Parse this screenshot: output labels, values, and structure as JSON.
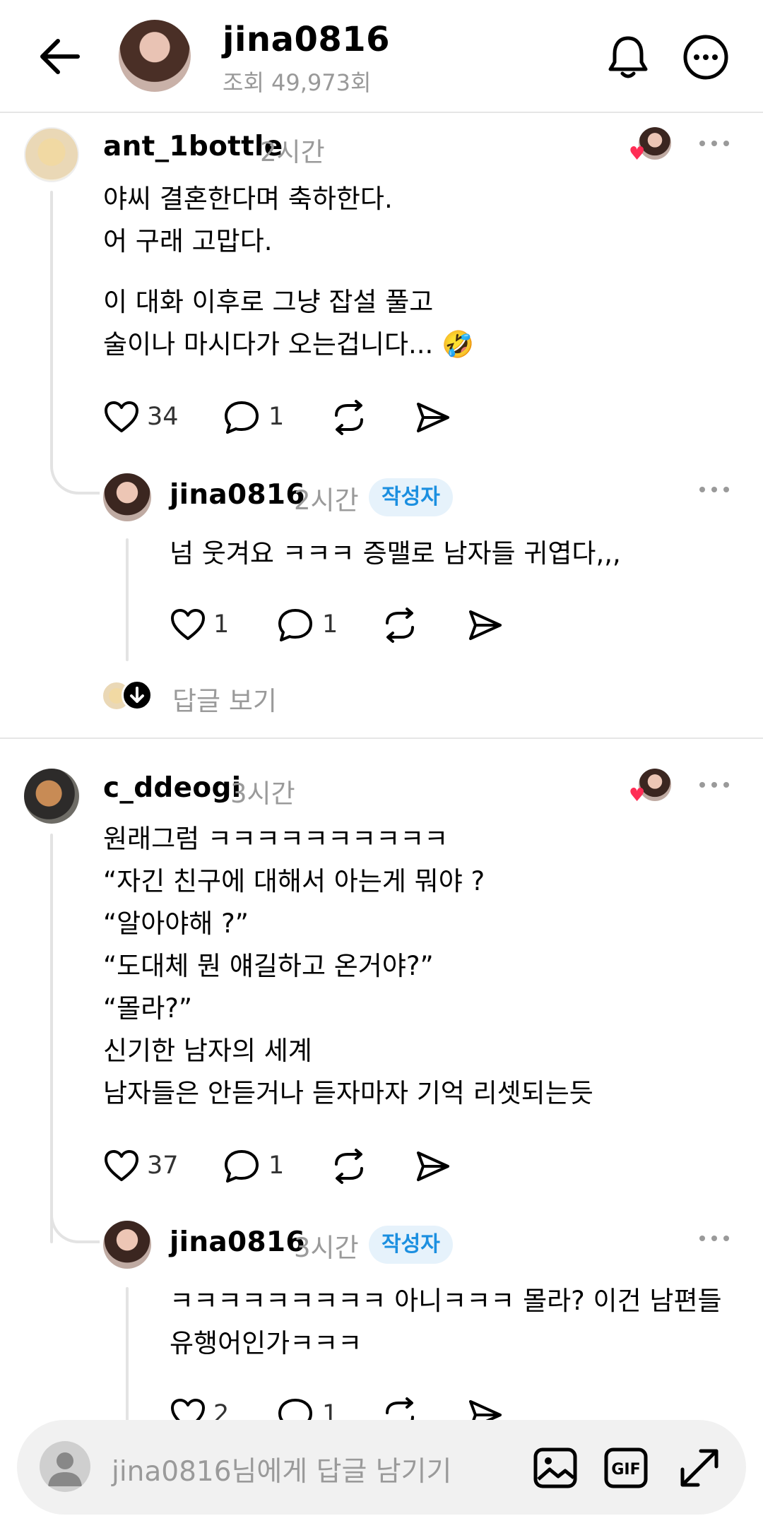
{
  "header": {
    "username": "jina0816",
    "views": "조회 49,973회",
    "back_icon": "arrow-left-icon",
    "bell_icon": "bell-icon",
    "more_icon": "more-circle-icon"
  },
  "threads": [
    {
      "username": "ant_1bottle",
      "time": "2시간",
      "body": [
        "야씨 결혼한다며 축하한다.",
        "어 구래 고맙다.",
        "이 대화 이후로 그냥 잡설 풀고",
        "술이나 마시다가 오는겁니다... 🤣"
      ],
      "likes": "34",
      "comments": "1",
      "reply": {
        "username": "jina0816",
        "time": "2시간",
        "badge": "작성자",
        "body": [
          "넘 웃겨요 ㅋㅋㅋ 증맬로 남자들 귀엽다,,,"
        ],
        "likes": "1",
        "comments": "1"
      },
      "view_replies": "답글 보기"
    },
    {
      "username": "c_ddeogi",
      "time": "3시간",
      "body": [
        "원래그럼 ㅋㅋㅋㅋㅋㅋㅋㅋㅋㅋ",
        "“자긴 친구에 대해서 아는게 뭐야 ?",
        "“알아야해 ?”",
        "“도대체 뭔 얘길하고 온거야?”",
        "“몰라?”",
        "신기한 남자의 세계",
        "남자들은 안듣거나 듣자마자 기억 리셋되는듯"
      ],
      "likes": "37",
      "comments": "1",
      "reply": {
        "username": "jina0816",
        "time": "3시간",
        "badge": "작성자",
        "body": [
          "ㅋㅋㅋㅋㅋㅋㅋㅋㅋ 아니ㅋㅋㅋ 몰라? 이건 남편들",
          "유행어인가ㅋㅋㅋ"
        ],
        "likes": "2",
        "comments": "1"
      }
    }
  ],
  "composer": {
    "placeholder": "jina0816님에게 답글 남기기",
    "tools": [
      "image-icon",
      "gif-icon",
      "expand-icon"
    ]
  },
  "colors": {
    "badge_bg": "#e6f2fb",
    "badge_text": "#1b8fe0",
    "heart": "#ff2d55",
    "muted_text": "#9a9a9a"
  }
}
